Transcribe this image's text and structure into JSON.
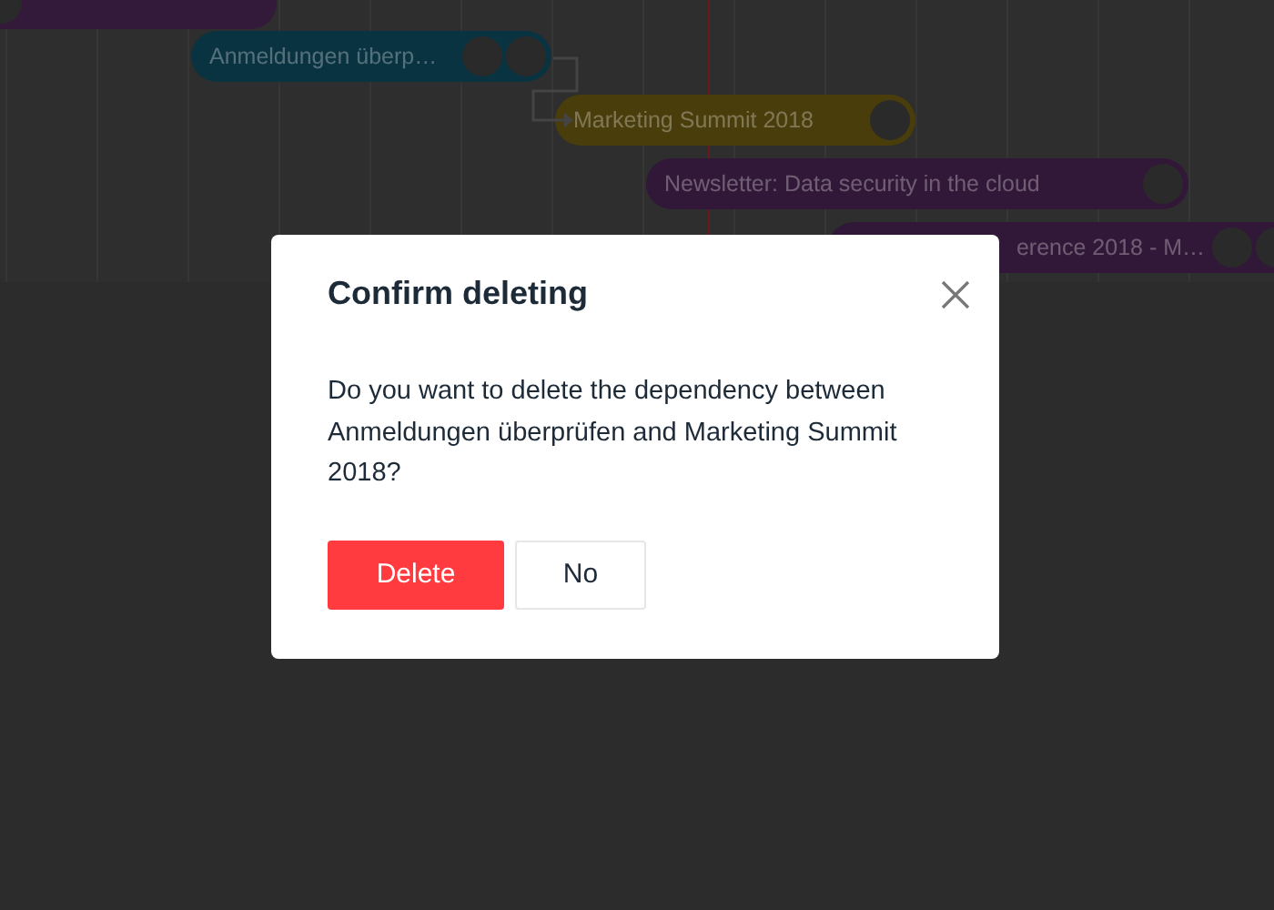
{
  "gantt": {
    "bars": [
      {
        "color": "#331a3a"
      },
      {
        "label": "Anmeldungen überp…",
        "color": "#0a3342"
      },
      {
        "label": "Marketing Summit 2018",
        "color": "#4a3d0c"
      },
      {
        "label": "Newsletter: Data security in the cloud",
        "color": "#321838"
      },
      {
        "label": "erence 2018 - M…",
        "color": "#321838"
      }
    ]
  },
  "dialog": {
    "title": "Confirm deleting",
    "message": "Do you want to delete the dependency between Anmeldungen überprüfen and Marketing Summit 2018?",
    "buttons": [
      {
        "label": "Delete",
        "kind": "danger"
      },
      {
        "label": "No",
        "kind": "plain"
      }
    ]
  }
}
